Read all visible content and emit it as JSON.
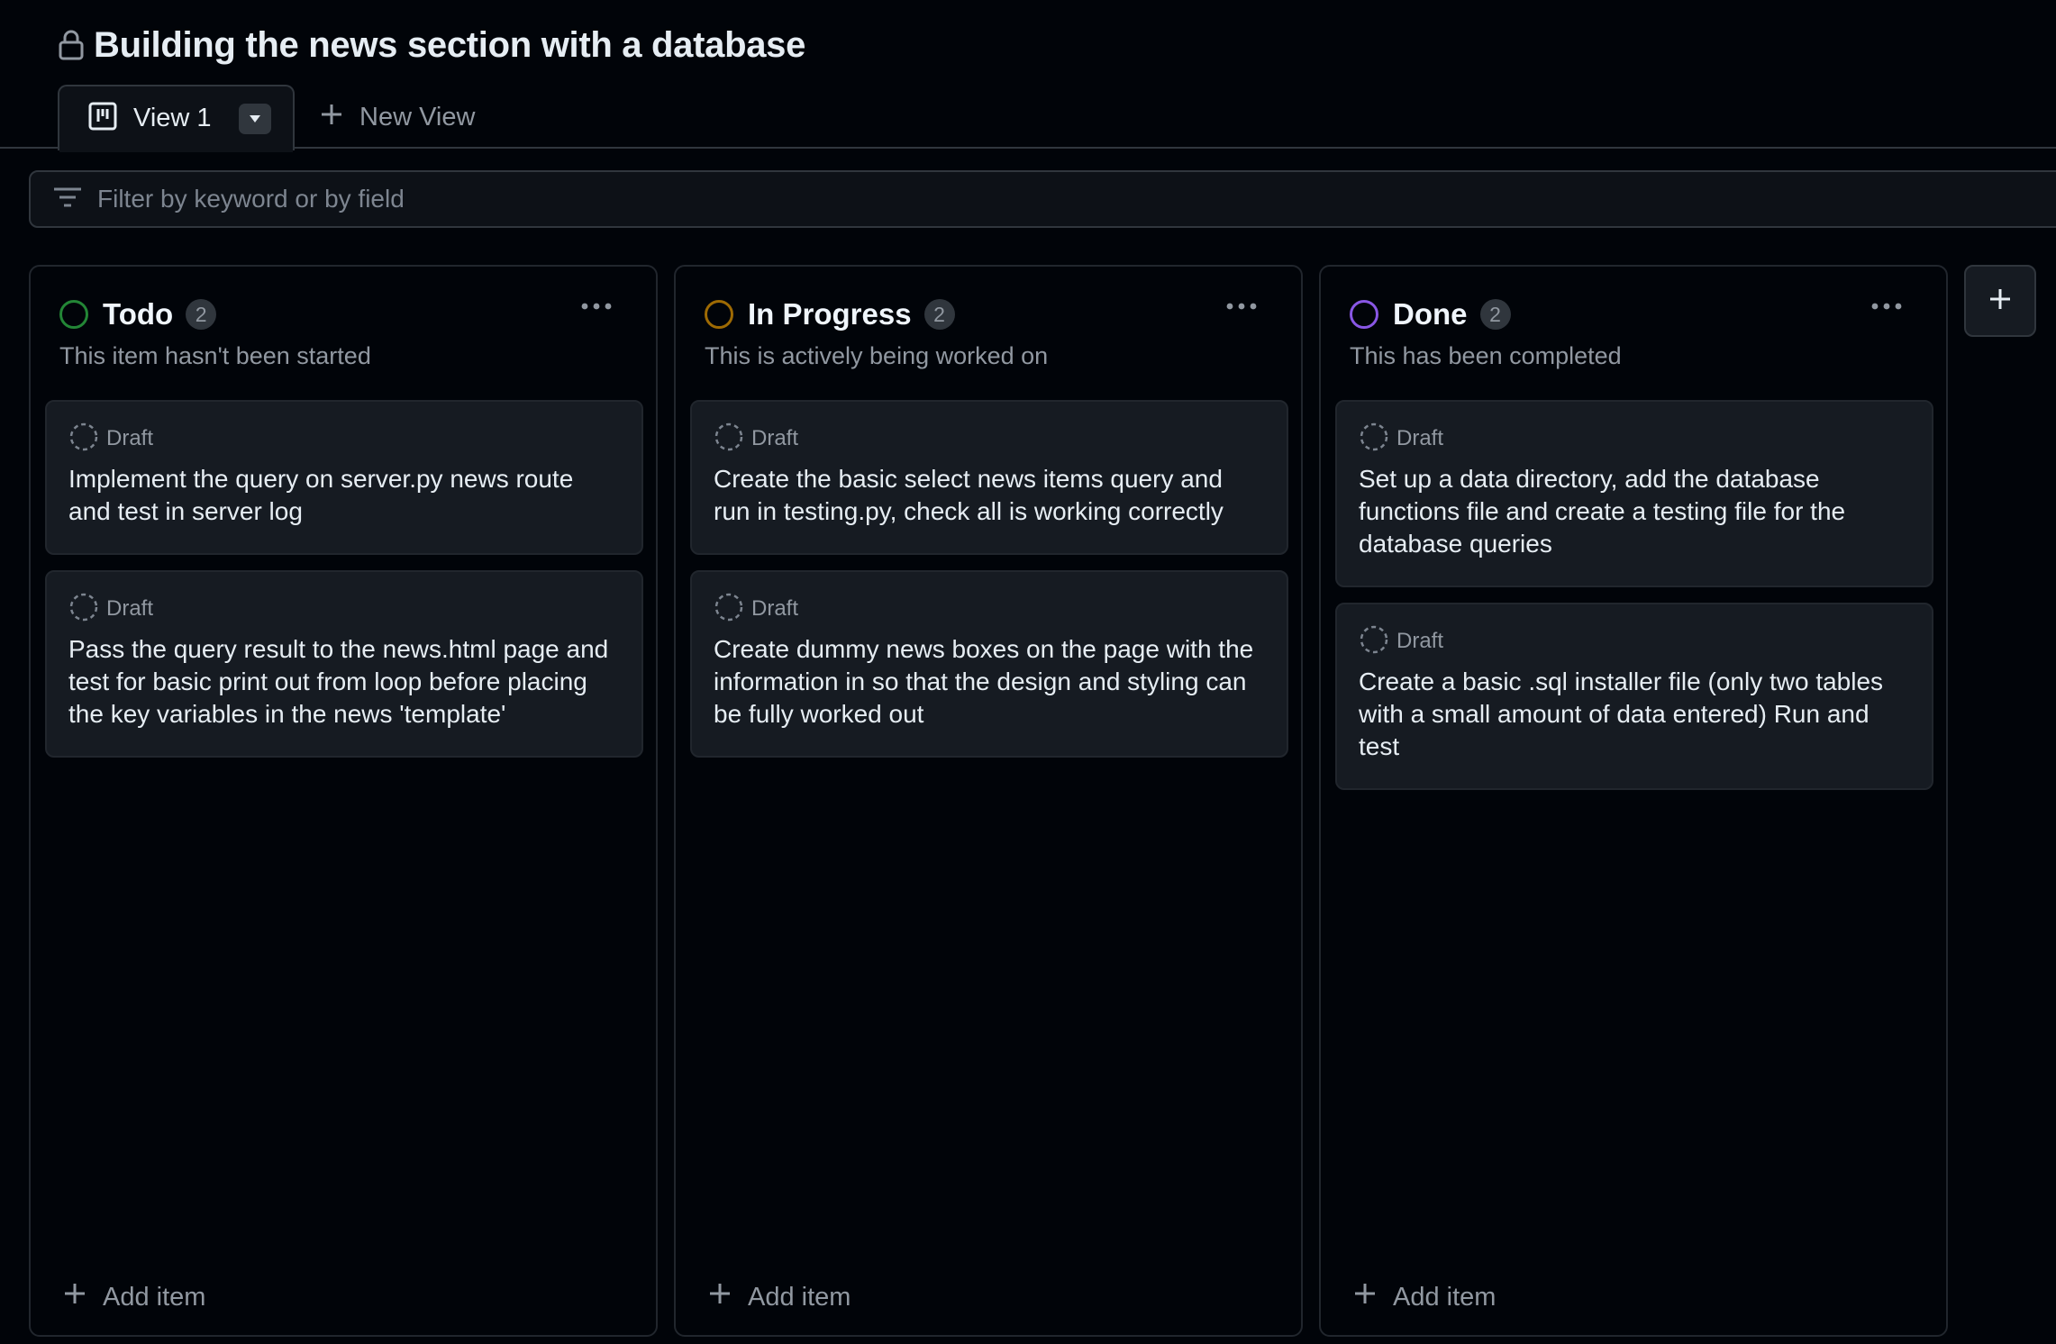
{
  "project": {
    "title": "Building the news section with a database"
  },
  "tabs": {
    "active_label": "View 1",
    "new_view_label": "New View"
  },
  "filter": {
    "placeholder": "Filter by keyword or by field"
  },
  "colors": {
    "todo": "#238636",
    "in_progress": "#9e6a03",
    "done": "#8957e5"
  },
  "columns": [
    {
      "name": "Todo",
      "count": "2",
      "description": "This item hasn't been started",
      "status_color": "#238636",
      "add_item_label": "Add item",
      "cards": [
        {
          "status": "Draft",
          "title": "Implement the query on server.py news route and test in server log"
        },
        {
          "status": "Draft",
          "title": "Pass the query result to the news.html page and test for basic print out from loop before placing the key variables in the news 'template'"
        }
      ]
    },
    {
      "name": "In Progress",
      "count": "2",
      "description": "This is actively being worked on",
      "status_color": "#9e6a03",
      "add_item_label": "Add item",
      "cards": [
        {
          "status": "Draft",
          "title": "Create the basic select news items query and run in testing.py, check all is working correctly"
        },
        {
          "status": "Draft",
          "title": "Create dummy news boxes on the page with the information in so that the design and styling can be fully worked out"
        }
      ]
    },
    {
      "name": "Done",
      "count": "2",
      "description": "This has been completed",
      "status_color": "#8957e5",
      "add_item_label": "Add item",
      "cards": [
        {
          "status": "Draft",
          "title": "Set up a data directory, add the database functions file and create a testing file for the database queries"
        },
        {
          "status": "Draft",
          "title": "Create a basic .sql installer file (only two tables with a small amount of data entered) Run and test"
        }
      ]
    }
  ],
  "icons": {
    "lock": "lock-icon",
    "board": "board-icon",
    "dropdown": "triangle-down-icon",
    "plus": "plus-icon",
    "filter": "filter-icon",
    "kebab": "kebab-horizontal-icon",
    "draft": "draft-circle-icon"
  }
}
